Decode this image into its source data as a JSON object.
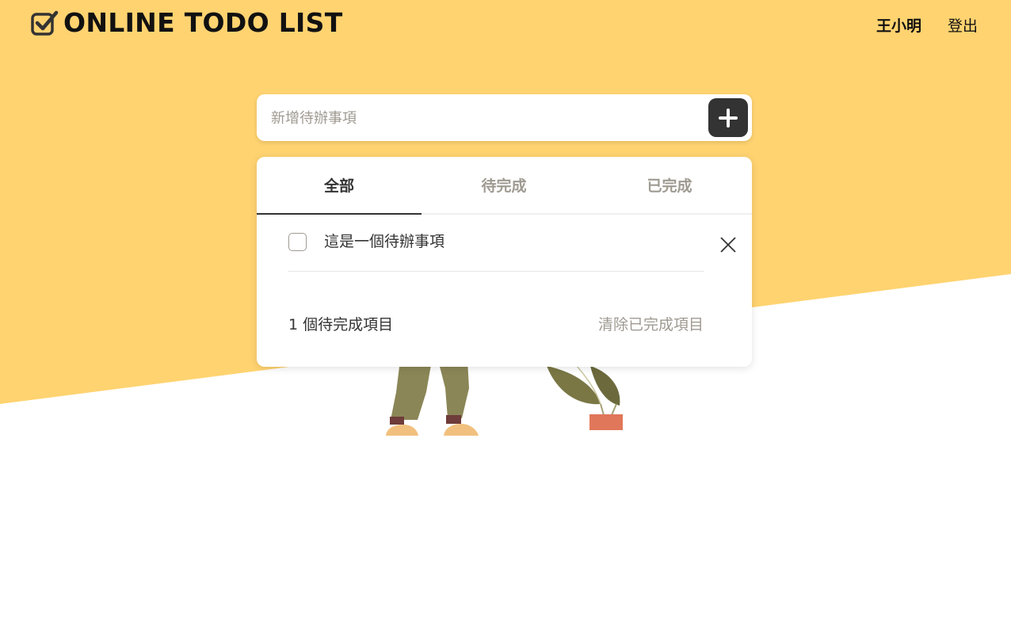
{
  "brand": {
    "title": "ONLINE TODO LIST",
    "icon": "checkbox-check-icon"
  },
  "user": {
    "name": "王小明",
    "logout_label": "登出"
  },
  "add_todo": {
    "placeholder": "新增待辦事項",
    "value": "",
    "button_icon": "plus-icon"
  },
  "tabs": [
    {
      "label": "全部",
      "active": true
    },
    {
      "label": "待完成",
      "active": false
    },
    {
      "label": "已完成",
      "active": false
    }
  ],
  "todos": [
    {
      "text": "這是一個待辦事項",
      "done": false,
      "delete_icon": "close-icon"
    }
  ],
  "footer": {
    "pending_count": "1 個待完成項目",
    "clear_label": "清除已完成項目"
  },
  "colors": {
    "accent": "#ffd370",
    "primary_dark": "#333333",
    "muted_text": "#9f9a91",
    "white": "#ffffff"
  }
}
